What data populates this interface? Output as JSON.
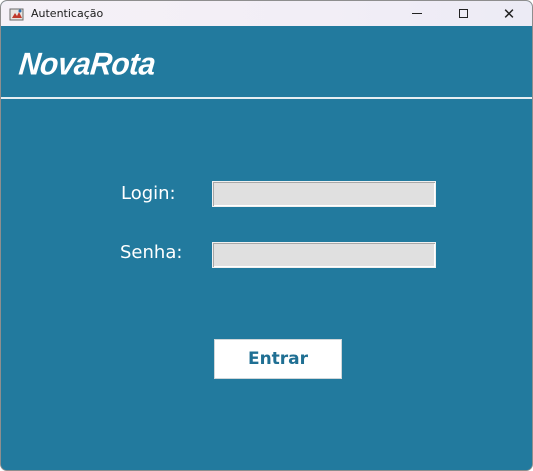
{
  "window": {
    "title": "Autenticação",
    "icon": "java-app-icon",
    "controls": {
      "minimize": "minimize-icon",
      "maximize": "maximize-icon",
      "close": "close-icon"
    }
  },
  "header": {
    "logo_text": "NovaRota"
  },
  "form": {
    "login_label": "Login:",
    "login_value": "",
    "password_label": "Senha:",
    "password_value": "",
    "submit_label": "Entrar"
  },
  "colors": {
    "background": "#227a9e",
    "button_text": "#1f6f93",
    "field_background": "#e0e0e0"
  }
}
